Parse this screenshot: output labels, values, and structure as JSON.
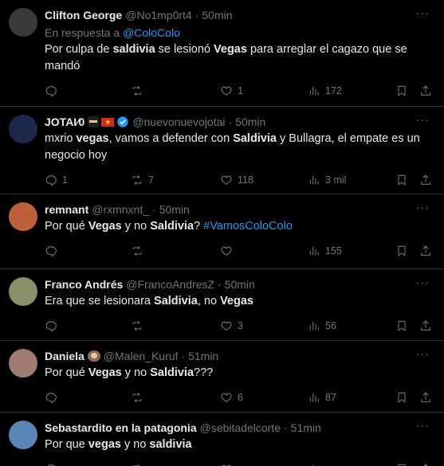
{
  "tweets": [
    {
      "name": "Clifton George",
      "handle": "@No1mp0rt4",
      "time": "50min",
      "reply_prefix": "En respuesta a ",
      "reply_mention": "@ColoColo",
      "text_parts": [
        {
          "t": "Por culpa de ",
          "b": false
        },
        {
          "t": "saldivia",
          "b": true
        },
        {
          "t": " se lesionó ",
          "b": false
        },
        {
          "t": "Vegas",
          "b": true
        },
        {
          "t": " para arreglar el cagazo que se mandó",
          "b": false
        }
      ],
      "replies": "",
      "retweets": "",
      "likes": "1",
      "views": "172",
      "avatar_color": "#3a3a3a"
    },
    {
      "name": "JOTAI⁄0",
      "handle": "@nuevonuevojotai",
      "time": "50min",
      "badges": [
        "ninja-emoji",
        "vietnam-flag-emoji",
        "verified-badge"
      ],
      "text_parts": [
        {
          "t": "mxrio ",
          "b": false
        },
        {
          "t": "vegas",
          "b": true
        },
        {
          "t": ", vamos a defender con ",
          "b": false
        },
        {
          "t": "Saldivia",
          "b": true
        },
        {
          "t": " y Bullagra, el empate es un negocio hoy",
          "b": false
        }
      ],
      "replies": "1",
      "retweets": "7",
      "likes": "118",
      "views": "3 mil",
      "avatar_color": "#1b2a4a"
    },
    {
      "name": "remnant",
      "handle": "@rxmnxnt_",
      "time": "50min",
      "text_parts": [
        {
          "t": "Por qué ",
          "b": false
        },
        {
          "t": "Vegas",
          "b": true
        },
        {
          "t": " y no ",
          "b": false
        },
        {
          "t": "Saldivia",
          "b": true
        },
        {
          "t": "? ",
          "b": false
        },
        {
          "t": "#VamosColoColo",
          "b": false,
          "hashtag": true
        }
      ],
      "replies": "",
      "retweets": "",
      "likes": "",
      "views": "155",
      "avatar_color": "#c0603a"
    },
    {
      "name": "Franco Andrés",
      "handle": "@FrancoAndresZ",
      "time": "50min",
      "text_parts": [
        {
          "t": "Era que se lesionara ",
          "b": false
        },
        {
          "t": "Saldivia",
          "b": true
        },
        {
          "t": ", no ",
          "b": false
        },
        {
          "t": "Vegas",
          "b": true
        }
      ],
      "replies": "",
      "retweets": "",
      "likes": "3",
      "views": "56",
      "avatar_color": "#8a8f6a"
    },
    {
      "name": "Daniela",
      "handle": "@Malen_Kuruf",
      "time": "51min",
      "badges": [
        "sloth-emoji"
      ],
      "text_parts": [
        {
          "t": "Por qué ",
          "b": false
        },
        {
          "t": "Vegas",
          "b": true
        },
        {
          "t": " y no ",
          "b": false
        },
        {
          "t": "Saldivia",
          "b": true
        },
        {
          "t": "???",
          "b": false
        }
      ],
      "replies": "",
      "retweets": "",
      "likes": "6",
      "views": "87",
      "avatar_color": "#a07b70"
    },
    {
      "name": "Sebastardito en la patagonia",
      "handle": "@sebitadelcorte",
      "time": "51min",
      "text_parts": [
        {
          "t": "Por que ",
          "b": false
        },
        {
          "t": "vegas",
          "b": true
        },
        {
          "t": " y no ",
          "b": false
        },
        {
          "t": "saldivia",
          "b": true
        }
      ],
      "replies": "",
      "retweets": "",
      "likes": "",
      "views": "",
      "avatar_color": "#5a86b8"
    }
  ],
  "more_symbol": "···",
  "separator": "·"
}
